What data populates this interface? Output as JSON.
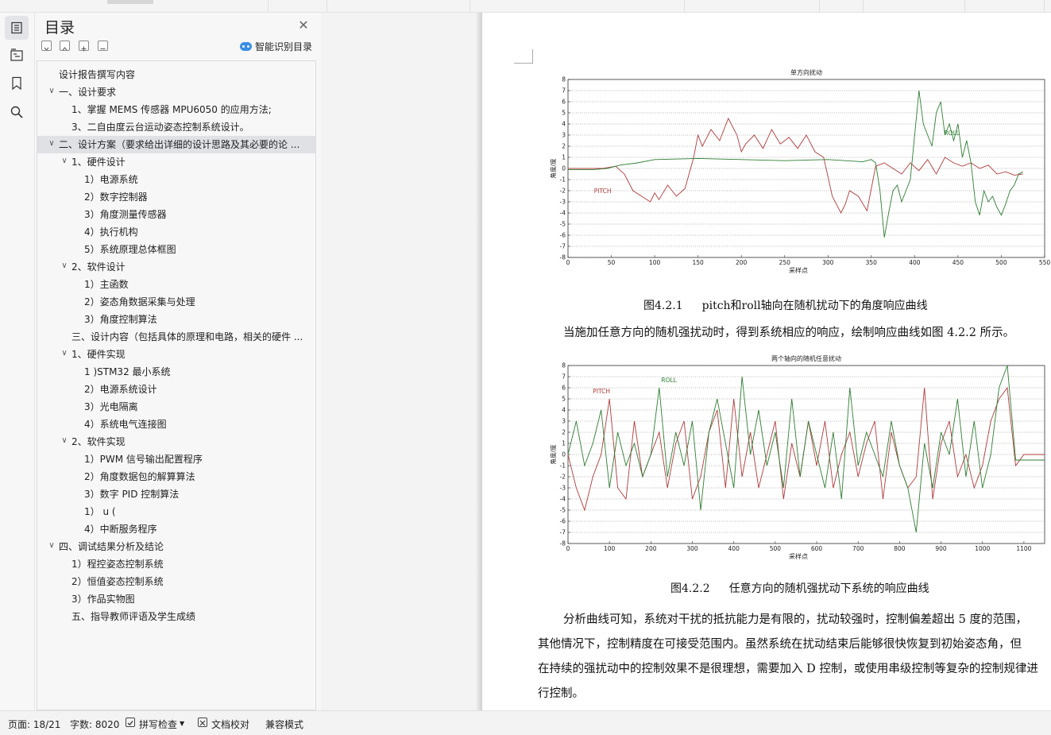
{
  "toc": {
    "title": "目录",
    "smart_label": "智能识别目录",
    "items": [
      {
        "label": "设计报告撰写内容",
        "level": 0,
        "chevron": false
      },
      {
        "label": "一、设计要求",
        "level": 0,
        "chevron": true
      },
      {
        "label": "1、掌握 MEMS 传感器 MPU6050 的应用方法;",
        "level": 2,
        "chevron": false
      },
      {
        "label": "3、二自由度云台运动姿态控制系统设计。",
        "level": 2,
        "chevron": false
      },
      {
        "label": "二、设计方案（要求给出详细的设计思路及其必要的论 ...",
        "level": 0,
        "chevron": true,
        "selected": true
      },
      {
        "label": "1、硬件设计",
        "level": 1,
        "chevron": true
      },
      {
        "label": "1）电源系统",
        "level": 3,
        "chevron": false
      },
      {
        "label": "2）数字控制器",
        "level": 3,
        "chevron": false
      },
      {
        "label": "3）角度测量传感器",
        "level": 3,
        "chevron": false
      },
      {
        "label": "4）执行机构",
        "level": 3,
        "chevron": false
      },
      {
        "label": "5）系统原理总体框图",
        "level": 3,
        "chevron": false
      },
      {
        "label": "2、软件设计",
        "level": 1,
        "chevron": true
      },
      {
        "label": "1）主函数",
        "level": 3,
        "chevron": false
      },
      {
        "label": "2）姿态角数据采集与处理",
        "level": 3,
        "chevron": false
      },
      {
        "label": "3）角度控制算法",
        "level": 3,
        "chevron": false
      },
      {
        "label": "三、设计内容（包括具体的原理和电路，相关的硬件 ...",
        "level": 2,
        "chevron": false
      },
      {
        "label": "1、硬件实现",
        "level": 1,
        "chevron": true
      },
      {
        "label": "1 )STM32 最小系统",
        "level": 3,
        "chevron": false
      },
      {
        "label": "2）电源系统设计",
        "level": 3,
        "chevron": false
      },
      {
        "label": "3）光电隔离",
        "level": 3,
        "chevron": false
      },
      {
        "label": "4）系统电气连接图",
        "level": 3,
        "chevron": false
      },
      {
        "label": "2、软件实现",
        "level": 1,
        "chevron": true
      },
      {
        "label": "1）PWM 信号输出配置程序",
        "level": 3,
        "chevron": false
      },
      {
        "label": "2）角度数据包的解算算法",
        "level": 3,
        "chevron": false
      },
      {
        "label": "3）数字 PID 控制算法",
        "level": 3,
        "chevron": false
      },
      {
        "label": "1）       u (",
        "level": 3,
        "chevron": false
      },
      {
        "label": "4）中断服务程序",
        "level": 3,
        "chevron": false
      },
      {
        "label": "四、调试结果分析及结论",
        "level": 0,
        "chevron": true
      },
      {
        "label": "1）程控姿态控制系统",
        "level": 2,
        "chevron": false
      },
      {
        "label": "2）恒值姿态控制系统",
        "level": 2,
        "chevron": false
      },
      {
        "label": "3）作品实物图",
        "level": 2,
        "chevron": false
      },
      {
        "label": "五、指导教师评语及学生成绩",
        "level": 2,
        "chevron": false
      }
    ]
  },
  "rail_icons": [
    "toc-icon",
    "navigation-icon",
    "bookmark-icon",
    "search-icon"
  ],
  "document": {
    "caption1_num": "图4.2.1",
    "caption1_text": "pitch和roll轴向在随机扰动下的角度响应曲线",
    "para1": "当施加任意方向的随机强扰动时，得到系统相应的响应，绘制响应曲线如图 4.2.2 所示。",
    "caption2_num": "图4.2.2",
    "caption2_text": "任意方向的随机强扰动下系统的响应曲线",
    "para2_lines": [
      "分析曲线可知，系统对干扰的抵抗能力是有限的，扰动较强时，控制偏差超出 5 度的范围，",
      "其他情况下，控制精度在可接受范围内。虽然系统在扰动结束后能够很快恢复到初始姿态角，但",
      "在持续的强扰动中的控制效果不是很理想，需要加入 D 控制，或使用串级控制等复杂的控制规律进",
      "行控制。"
    ]
  },
  "chart_data": [
    {
      "type": "line",
      "title": "单方向扰动",
      "xlabel": "采样点",
      "ylabel": "角度/度",
      "xlim": [
        0,
        550
      ],
      "ylim": [
        -8,
        8
      ],
      "xticks": [
        0,
        50,
        100,
        150,
        200,
        250,
        300,
        350,
        400,
        450,
        500,
        550
      ],
      "yticks": [
        8,
        7,
        6,
        5,
        4,
        3,
        2,
        1,
        0,
        -1,
        -2,
        -3,
        -4,
        -5,
        -6,
        -7,
        -8
      ],
      "grid": true,
      "colors": {
        "pitch": "#b03a3a",
        "roll": "#2e7d32"
      },
      "annotations": [
        {
          "text": "PITCH",
          "x": 30,
          "y": -2.2,
          "color": "#b03a3a"
        },
        {
          "text": "ROLL",
          "x": 434,
          "y": 3.0,
          "color": "#2e7d32"
        }
      ],
      "series": [
        {
          "key": "pitch",
          "x": [
            0,
            20,
            40,
            55,
            65,
            75,
            85,
            95,
            100,
            105,
            115,
            125,
            135,
            145,
            150,
            155,
            165,
            175,
            185,
            195,
            200,
            205,
            215,
            225,
            235,
            245,
            255,
            265,
            275,
            285,
            295,
            305,
            315,
            320,
            325,
            335,
            345,
            355,
            365,
            375,
            385,
            395,
            405,
            415,
            425,
            435,
            445,
            455,
            465,
            475,
            485,
            495,
            505,
            515,
            525
          ],
          "y": [
            0,
            0,
            0,
            0.2,
            -0.5,
            -2,
            -2.5,
            -3,
            -2.2,
            -2.8,
            -1.5,
            -2.5,
            -1.8,
            1,
            3,
            2,
            3.5,
            2.5,
            4.5,
            3,
            1.5,
            2.2,
            3,
            1.8,
            3.5,
            2.2,
            2.8,
            1.8,
            3,
            1.5,
            1,
            -2.5,
            -4,
            -3.2,
            -2,
            -2.5,
            -3.8,
            0.2,
            0.5,
            0,
            -0.5,
            0.5,
            -0.2,
            0.8,
            -0.5,
            1,
            0.5,
            0.2,
            0.5,
            0,
            0.3,
            -0.5,
            -0.3,
            -0.6,
            -0.5
          ]
        },
        {
          "key": "roll",
          "x": [
            0,
            30,
            45,
            60,
            80,
            100,
            150,
            200,
            250,
            300,
            340,
            350,
            355,
            360,
            365,
            370,
            375,
            380,
            385,
            395,
            400,
            405,
            410,
            420,
            425,
            430,
            435,
            440,
            445,
            450,
            455,
            460,
            465,
            470,
            475,
            480,
            485,
            490,
            495,
            500,
            505,
            510,
            515,
            520,
            525
          ],
          "y": [
            -0.1,
            -0.1,
            0,
            0.3,
            0.5,
            0.8,
            0.9,
            0.8,
            0.7,
            0.8,
            0.6,
            0.8,
            0.5,
            -2,
            -6.2,
            -4,
            -2,
            -1.5,
            -3,
            -1,
            3,
            7,
            4,
            2,
            5,
            6,
            3,
            4,
            2.5,
            4,
            1,
            2.5,
            0.5,
            -3,
            -4.2,
            -2,
            -3,
            -2.5,
            -3.5,
            -4.2,
            -3.2,
            -2,
            -1.5,
            -0.5,
            -0.3
          ]
        }
      ]
    },
    {
      "type": "line",
      "title": "两个轴向的随机任意扰动",
      "xlabel": "采样点",
      "ylabel": "角度/度",
      "xlim": [
        0,
        1150
      ],
      "ylim": [
        -8,
        8
      ],
      "xticks": [
        0,
        100,
        200,
        300,
        400,
        500,
        600,
        700,
        800,
        900,
        1000,
        1100
      ],
      "yticks": [
        8,
        7,
        6,
        5,
        4,
        3,
        2,
        1,
        0,
        -1,
        -2,
        -3,
        -4,
        -5,
        -6,
        -7,
        -8
      ],
      "grid": true,
      "colors": {
        "pitch": "#b03a3a",
        "roll": "#2e7d32"
      },
      "annotations": [
        {
          "text": "PITCH",
          "x": 60,
          "y": 5.5,
          "color": "#b03a3a"
        },
        {
          "text": "ROLL",
          "x": 225,
          "y": 6.5,
          "color": "#2e7d32"
        }
      ],
      "series": [
        {
          "key": "pitch",
          "x": [
            0,
            20,
            40,
            60,
            80,
            100,
            120,
            140,
            160,
            180,
            200,
            220,
            240,
            260,
            280,
            300,
            320,
            340,
            360,
            380,
            400,
            420,
            440,
            460,
            480,
            500,
            520,
            540,
            560,
            580,
            600,
            620,
            640,
            660,
            680,
            700,
            720,
            740,
            760,
            780,
            800,
            820,
            840,
            860,
            880,
            900,
            920,
            940,
            960,
            980,
            1000,
            1020,
            1040,
            1060,
            1080,
            1100,
            1120,
            1150
          ],
          "y": [
            0,
            -3,
            -5,
            -2,
            0,
            5,
            -3,
            -4,
            3,
            -2,
            0,
            2,
            -3,
            1,
            3,
            -4,
            -2,
            2,
            4,
            -3,
            5,
            -2,
            2,
            -3,
            0,
            3,
            -4,
            1,
            -2,
            3,
            -1,
            3,
            -3,
            0,
            2,
            -2,
            1,
            3,
            -4,
            2,
            -1,
            -3,
            -2,
            6,
            -4,
            1,
            3,
            -2,
            0,
            -3,
            -1,
            3,
            5,
            6,
            -1,
            0,
            0,
            0
          ]
        },
        {
          "key": "roll",
          "x": [
            0,
            20,
            40,
            60,
            80,
            100,
            120,
            140,
            160,
            180,
            200,
            220,
            240,
            260,
            280,
            300,
            320,
            340,
            360,
            380,
            400,
            420,
            440,
            460,
            480,
            500,
            520,
            540,
            560,
            580,
            600,
            620,
            640,
            660,
            680,
            700,
            720,
            740,
            760,
            780,
            800,
            820,
            840,
            860,
            880,
            900,
            920,
            940,
            960,
            980,
            1000,
            1020,
            1040,
            1060,
            1080,
            1100,
            1120,
            1150
          ],
          "y": [
            0,
            3,
            -1,
            1,
            4,
            -3,
            2,
            -1,
            1,
            -2,
            0,
            6,
            -2,
            2,
            -1,
            3,
            -5,
            2,
            5,
            1,
            -3,
            7,
            0,
            4,
            -1,
            2,
            -3,
            5,
            -2,
            3,
            0,
            -3,
            2,
            -4,
            6,
            -1,
            2,
            0,
            -2,
            3,
            -1,
            -3,
            -7,
            1,
            -3,
            2,
            0,
            5,
            -2,
            3,
            -3,
            0,
            6,
            8,
            -0.5,
            -0.5,
            -0.5,
            -0.5
          ]
        }
      ]
    }
  ],
  "status": {
    "page": "页面: 18/21",
    "words": "字数: 8020",
    "spell": "拼写检查",
    "proof": "文档校对",
    "compat": "兼容模式"
  }
}
